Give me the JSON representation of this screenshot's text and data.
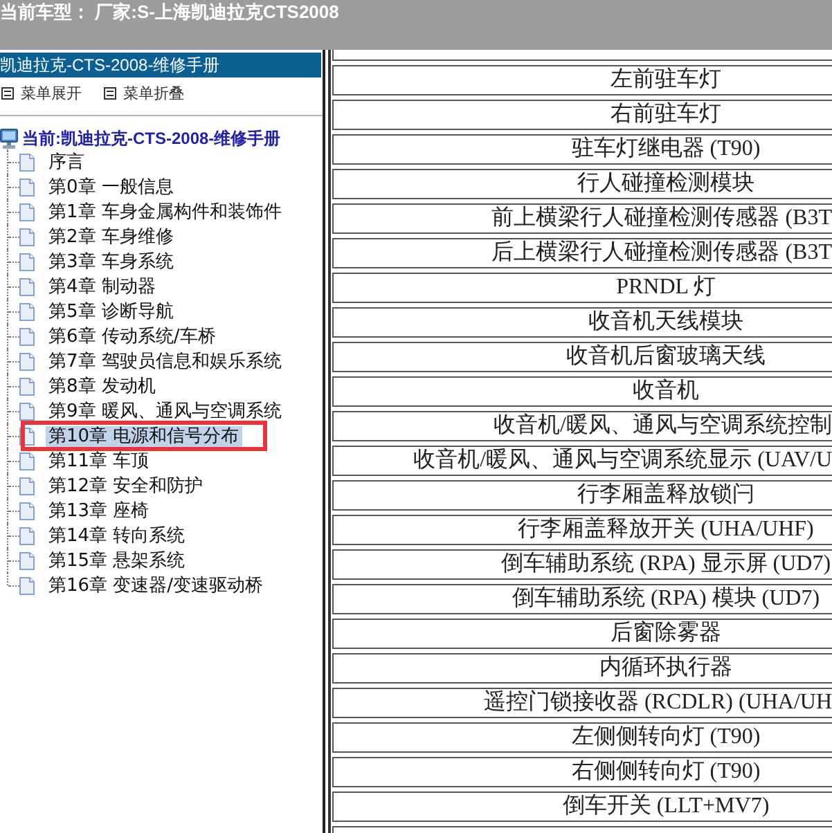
{
  "header": {
    "text": "当前车型： 厂家:S-上海凯迪拉克CTS2008"
  },
  "sidebar": {
    "title": "凯迪拉克-CTS-2008-维修手册",
    "menu_actions": [
      {
        "label": "菜单展开"
      },
      {
        "label": "菜单折叠"
      }
    ],
    "tree": {
      "label": "当前:凯迪拉克-CTS-2008-维修手册",
      "children": [
        {
          "label": "序言",
          "selected": false,
          "marked": false
        },
        {
          "label": "第0章 一般信息",
          "selected": false,
          "marked": false
        },
        {
          "label": "第1章 车身金属构件和装饰件",
          "selected": false,
          "marked": false
        },
        {
          "label": "第2章 车身维修",
          "selected": false,
          "marked": false
        },
        {
          "label": "第3章 车身系统",
          "selected": false,
          "marked": false
        },
        {
          "label": "第4章 制动器",
          "selected": false,
          "marked": false
        },
        {
          "label": "第5章 诊断导航",
          "selected": false,
          "marked": false
        },
        {
          "label": "第6章 传动系统/车桥",
          "selected": false,
          "marked": false
        },
        {
          "label": "第7章 驾驶员信息和娱乐系统",
          "selected": false,
          "marked": false
        },
        {
          "label": "第8章 发动机",
          "selected": false,
          "marked": false
        },
        {
          "label": "第9章 暖风、通风与空调系统",
          "selected": false,
          "marked": false
        },
        {
          "label": "第10章 电源和信号分布",
          "selected": true,
          "marked": true
        },
        {
          "label": "第11章 车顶",
          "selected": false,
          "marked": false
        },
        {
          "label": "第12章 安全和防护",
          "selected": false,
          "marked": false
        },
        {
          "label": "第13章 座椅",
          "selected": false,
          "marked": false
        },
        {
          "label": "第14章 转向系统",
          "selected": false,
          "marked": false
        },
        {
          "label": "第15章 悬架系统",
          "selected": false,
          "marked": false
        },
        {
          "label": "第16章 变速器/变速驱动桥",
          "selected": false,
          "marked": false
        }
      ]
    }
  },
  "content": {
    "rows": [
      {
        "kind": "cut_top"
      },
      {
        "kind": "full",
        "label": "左前驻车灯"
      },
      {
        "kind": "full",
        "label": "右前驻车灯"
      },
      {
        "kind": "full",
        "label": "驻车灯继电器 (T90)"
      },
      {
        "kind": "full",
        "label": "行人碰撞检测模块"
      },
      {
        "kind": "full",
        "label": "前上横梁行人碰撞检测传感器 (B3T"
      },
      {
        "kind": "full",
        "label": "后上横梁行人碰撞检测传感器 (B3T"
      },
      {
        "kind": "full",
        "label": "PRNDL 灯"
      },
      {
        "kind": "full",
        "label": "收音机天线模块"
      },
      {
        "kind": "full",
        "label": "收音机后窗玻璃天线"
      },
      {
        "kind": "full",
        "label": "收音机"
      },
      {
        "kind": "full",
        "label": "收音机/暖风、通风与空调系统控制"
      },
      {
        "kind": "full",
        "label": "收音机/暖风、通风与空调系统显示 (UAV/U"
      },
      {
        "kind": "full",
        "label": "行李厢盖释放锁闩"
      },
      {
        "kind": "full",
        "label": "行李厢盖释放开关 (UHA/UHF)"
      },
      {
        "kind": "full",
        "label": "倒车辅助系统 (RPA) 显示屏 (UD7)"
      },
      {
        "kind": "full",
        "label": "倒车辅助系统 (RPA) 模块 (UD7)"
      },
      {
        "kind": "full",
        "label": "后窗除雾器"
      },
      {
        "kind": "full",
        "label": "内循环执行器"
      },
      {
        "kind": "full",
        "label": "遥控门锁接收器 (RCDLR) (UHA/UH"
      },
      {
        "kind": "full",
        "label": "左侧侧转向灯 (T90)"
      },
      {
        "kind": "full",
        "label": "右侧侧转向灯 (T90)"
      },
      {
        "kind": "full",
        "label": "倒车开关 (LLT+MV7)"
      },
      {
        "kind": "cut_bottom"
      }
    ]
  }
}
